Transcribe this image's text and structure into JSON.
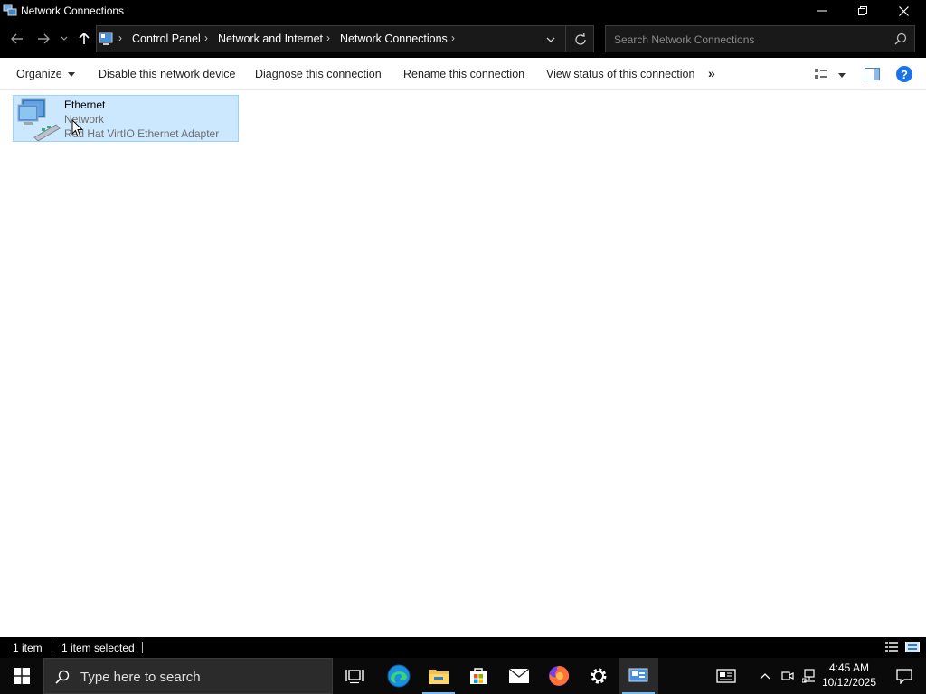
{
  "window": {
    "title": "Network Connections"
  },
  "address": {
    "breadcrumbs": [
      "Control Panel",
      "Network and Internet",
      "Network Connections"
    ],
    "search_placeholder": "Search Network Connections"
  },
  "commands": {
    "organize": "Organize",
    "disable": "Disable this network device",
    "diagnose": "Diagnose this connection",
    "rename": "Rename this connection",
    "view_status": "View status of this connection",
    "more": "»",
    "help": "?"
  },
  "items": [
    {
      "name": "Ethernet",
      "status": "Network",
      "device": "Red Hat VirtIO Ethernet Adapter",
      "selected": true,
      "icon": "network-adapter-icon"
    }
  ],
  "statusbar": {
    "count": "1 item",
    "selected": "1 item selected"
  },
  "taskbar": {
    "search_placeholder": "Type here to search",
    "apps": [
      "task-view-icon",
      "edge-icon",
      "file-explorer-icon",
      "store-icon",
      "mail-icon",
      "firefox-icon",
      "settings-icon",
      "control-panel-icon"
    ],
    "time": "4:45 AM",
    "date": "10/12/2025"
  },
  "colors": {
    "selection_bg": "#cce8ff",
    "selection_border": "#99d1ff",
    "help_blue": "#1a73e8",
    "taskbar_bg": "#0a0a0a"
  }
}
